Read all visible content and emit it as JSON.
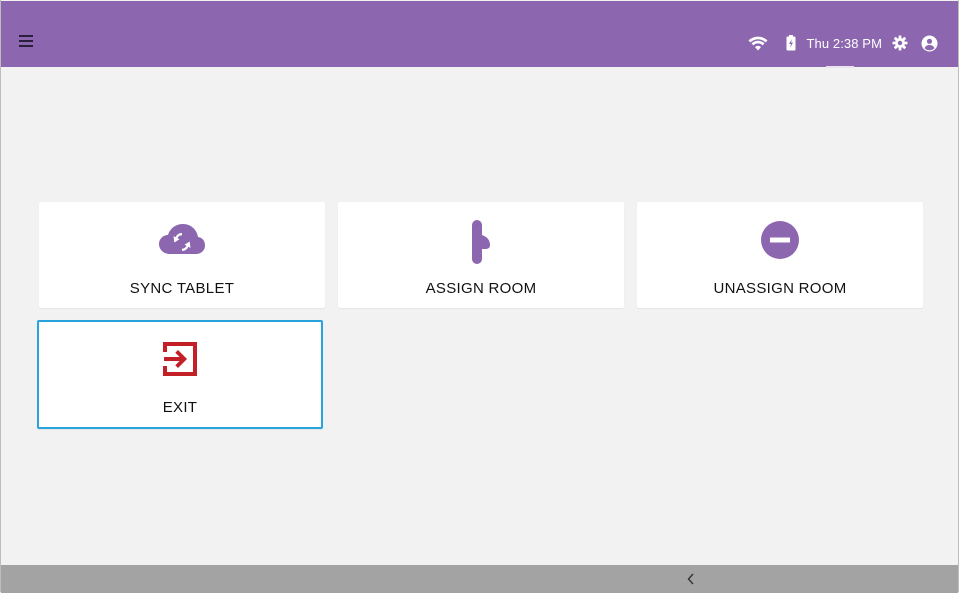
{
  "topbar": {
    "menu_icon": "hamburger-menu-icon",
    "status": {
      "wifi_icon": "wifi-icon",
      "battery_icon": "battery-charging-icon",
      "time": "Thu 2:38 PM",
      "settings_icon": "gear-icon",
      "account_icon": "account-circle-icon"
    },
    "color": "#8c66ae"
  },
  "tiles": [
    {
      "label": "SYNC TABLET",
      "icon": "cloud-sync-icon",
      "icon_color": "#8c66ae",
      "selected": false
    },
    {
      "label": "ASSIGN ROOM",
      "icon": "door-handle-icon",
      "icon_color": "#8c66ae",
      "selected": false
    },
    {
      "label": "UNASSIGN ROOM",
      "icon": "minus-circle-icon",
      "icon_color": "#8c66ae",
      "selected": false
    },
    {
      "label": "EXIT",
      "icon": "exit-icon",
      "icon_color": "#c21f27",
      "selected": true
    }
  ],
  "colors": {
    "accent": "#8c66ae",
    "exit_red": "#c21f27",
    "focus_border": "#29a3dd",
    "background": "#f2f2f2",
    "navbar": "#a3a3a3"
  },
  "navbar": {
    "back_icon": "chevron-left-icon"
  }
}
